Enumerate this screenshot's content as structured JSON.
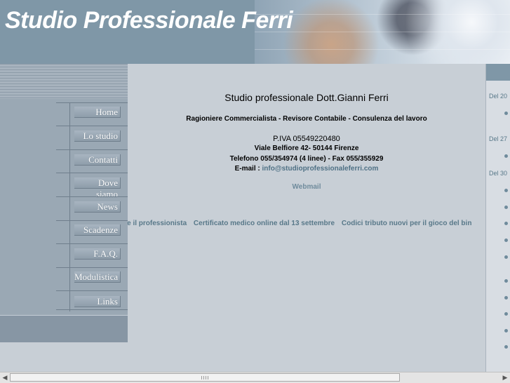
{
  "header": {
    "title": "Studio Professionale Ferri"
  },
  "nav": {
    "items": [
      {
        "label": "Home"
      },
      {
        "label": "Lo studio"
      },
      {
        "label": "Contatti"
      },
      {
        "label": "Dove siamo"
      },
      {
        "label": "News"
      },
      {
        "label": "Scadenze"
      },
      {
        "label": "F.A.Q."
      },
      {
        "label": "Modulistica"
      },
      {
        "label": "Links"
      }
    ]
  },
  "main": {
    "title": "Studio professionale Dott.Gianni Ferri",
    "subtitle": "Ragioniere Commercialista - Revisore Contabile - Consulenza del lavoro",
    "piva": "P.IVA 05549220480",
    "address": "Viale Belfiore 42- 50144 Firenze",
    "phone": "Telefono 055/354974 (4 linee) - Fax 055/355929",
    "email_label": "E-mail : ",
    "email": "info@studioprofessionaleferri.com",
    "webmail": "Webmail",
    "marquee": [
      "he il professionista",
      "Certificato medico online dal 13 settembre",
      "Codici tributo nuovi per il gioco del bin"
    ]
  },
  "news": {
    "dates": [
      "Del 20",
      "Del 27",
      "Del 30"
    ]
  },
  "scrollbar": {
    "left_arrow": "◀",
    "right_arrow": "▶"
  }
}
